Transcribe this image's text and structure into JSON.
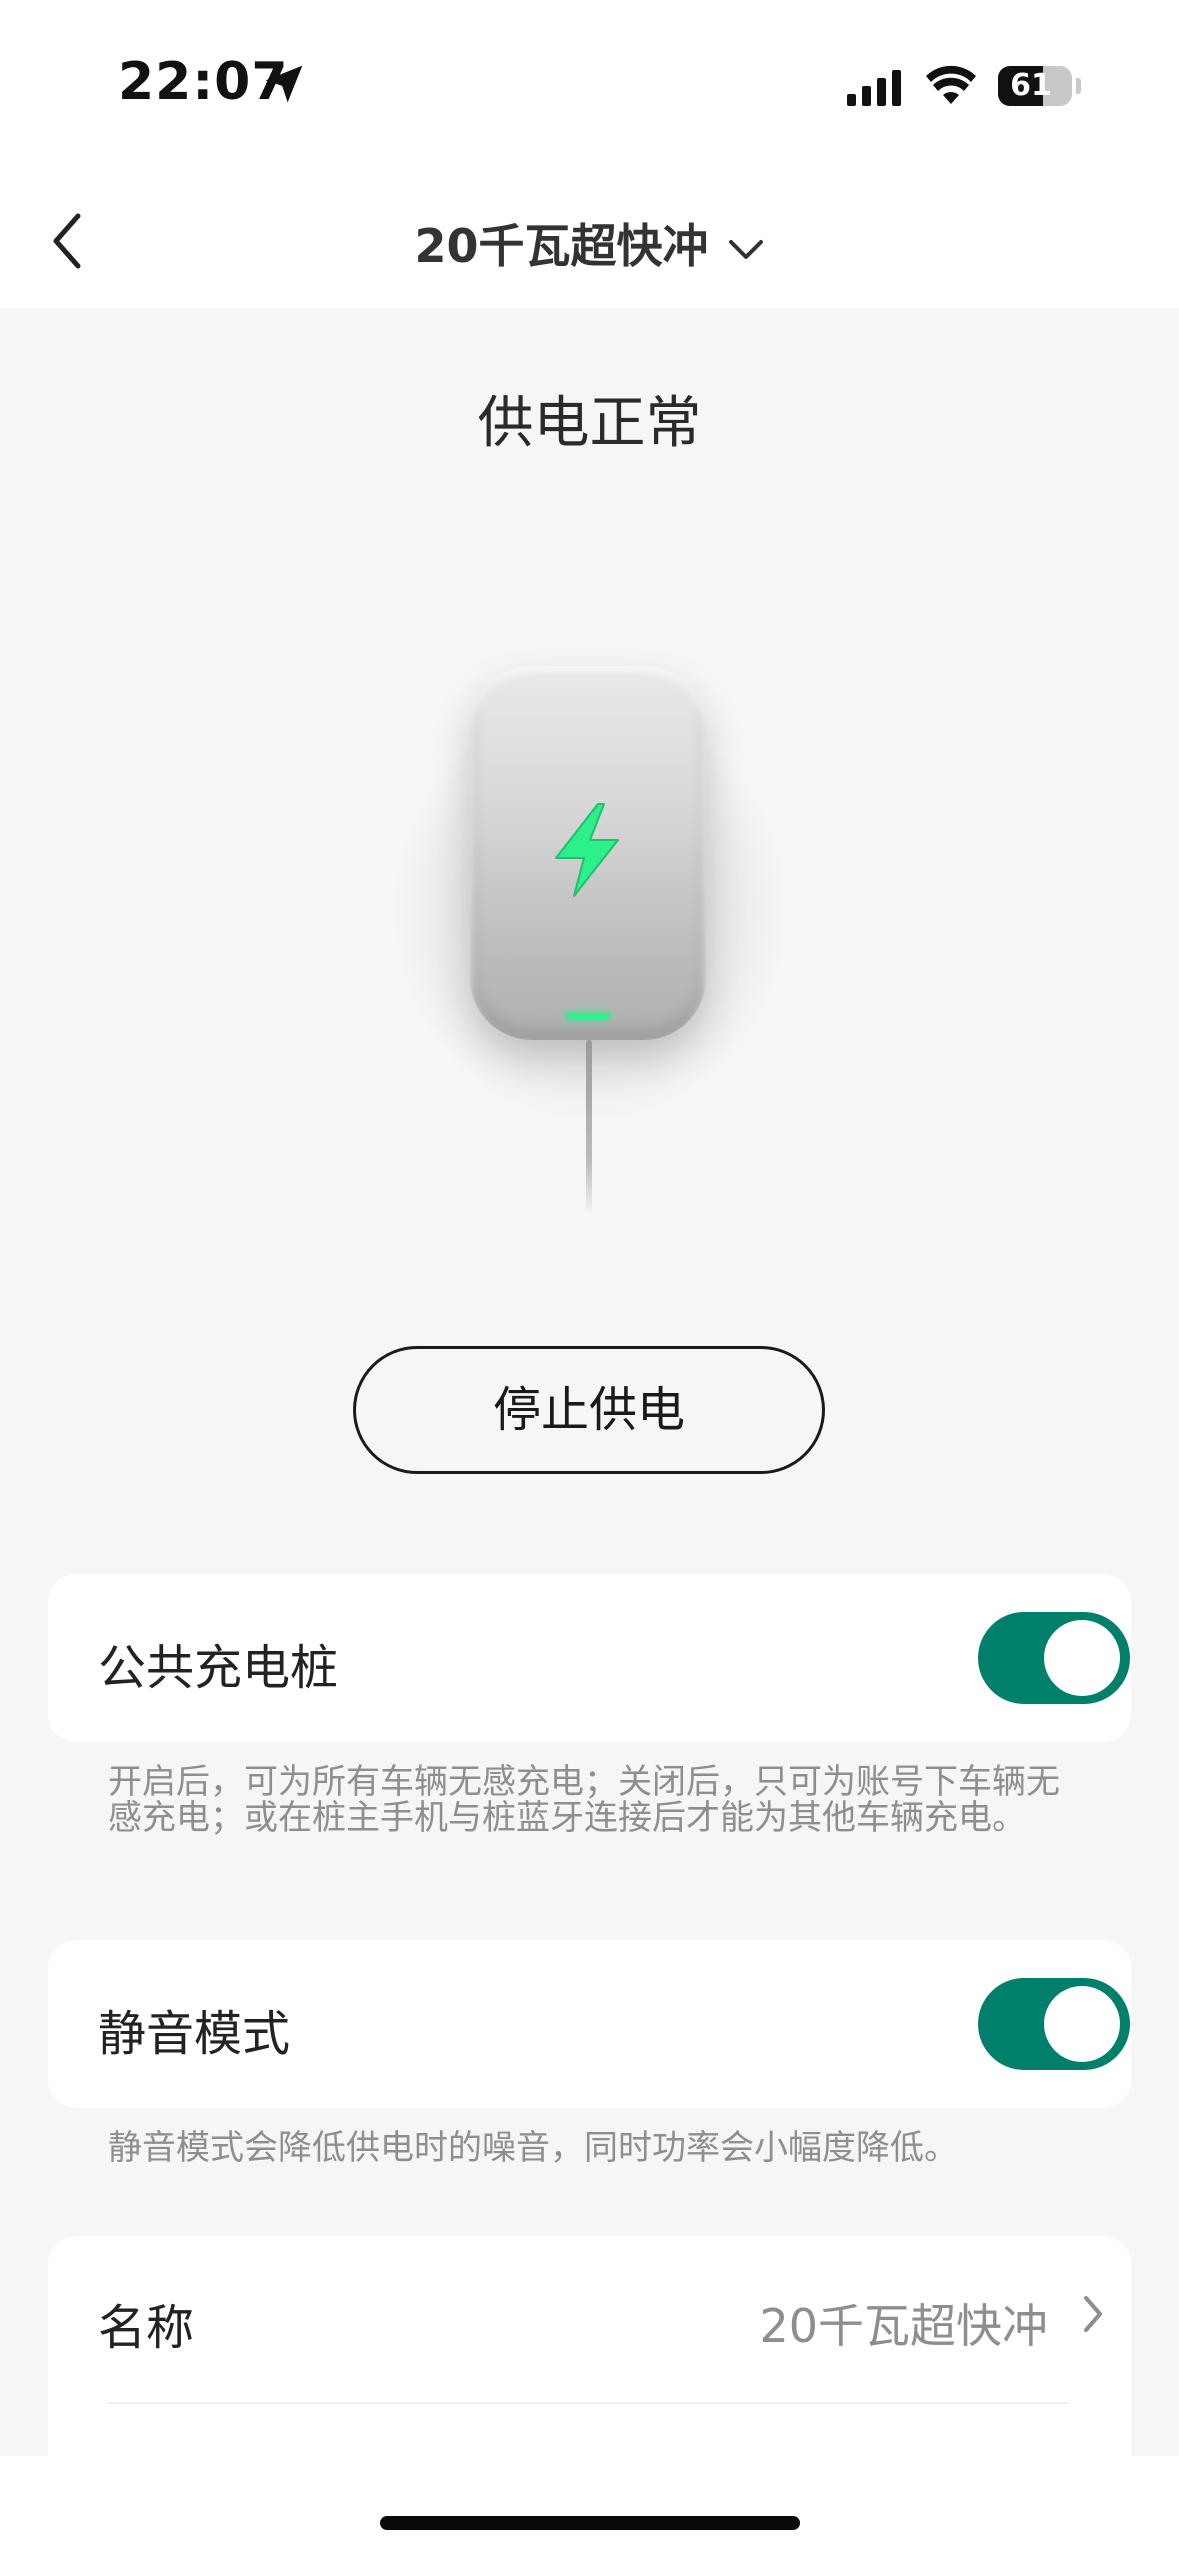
{
  "status_bar": {
    "time": "22:07",
    "battery_level": "61",
    "battery_fraction": 0.61,
    "icons": [
      "location-arrow-icon",
      "cellular-signal-icon",
      "wifi-icon",
      "battery-icon"
    ]
  },
  "nav": {
    "title": "20千瓦超快冲",
    "back_icon": "chevron-left-icon",
    "dropdown_icon": "chevron-down-icon"
  },
  "status": {
    "title": "供电正常"
  },
  "device": {
    "icon": "lightning-bolt-icon",
    "accent_color": "#2cf08a"
  },
  "actions": {
    "stop_label": "停止供电"
  },
  "settings": {
    "public_charger": {
      "label": "公共充电桩",
      "enabled": true,
      "note": "开启后，可为所有车辆无感充电；关闭后，只可为账号下车辆无感充电；或在桩主手机与桩蓝牙连接后才能为其他车辆充电。"
    },
    "silent_mode": {
      "label": "静音模式",
      "enabled": true,
      "note": "静音模式会降低供电时的噪音，同时功率会小幅度降低。"
    },
    "name": {
      "label": "名称",
      "value": "20千瓦超快冲"
    }
  },
  "colors": {
    "toggle_on": "#00806a",
    "background": "#f6f6f6"
  }
}
